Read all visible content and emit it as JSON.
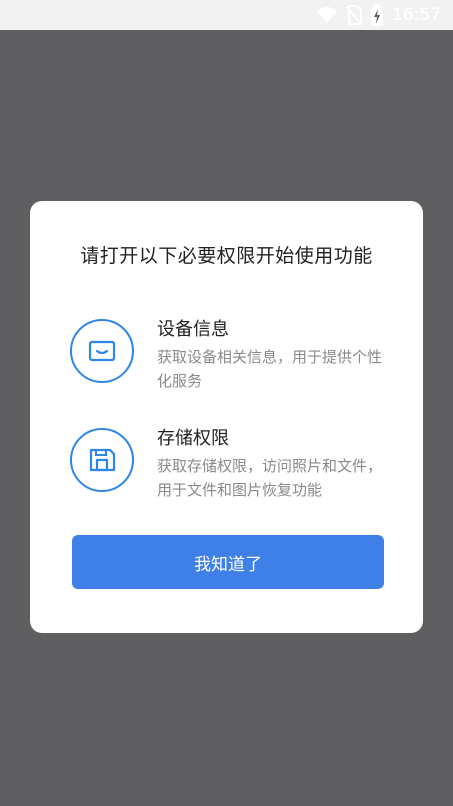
{
  "status_bar": {
    "time": "16:57",
    "icons": [
      "wifi-icon",
      "no-sim-icon",
      "battery-charging-icon"
    ]
  },
  "dialog": {
    "title": "请打开以下必要权限开始使用功能",
    "permissions": [
      {
        "icon": "device-info-icon",
        "name": "设备信息",
        "description": "获取设备相关信息，用于提供个性化服务"
      },
      {
        "icon": "storage-icon",
        "name": "存储权限",
        "description": "获取存储权限，访问照片和文件，用于文件和图片恢复功能"
      }
    ],
    "confirm_label": "我知道了"
  },
  "colors": {
    "accent": "#3f7fe8",
    "icon_ring": "#2f86e8",
    "overlay": "#5f5f61"
  }
}
